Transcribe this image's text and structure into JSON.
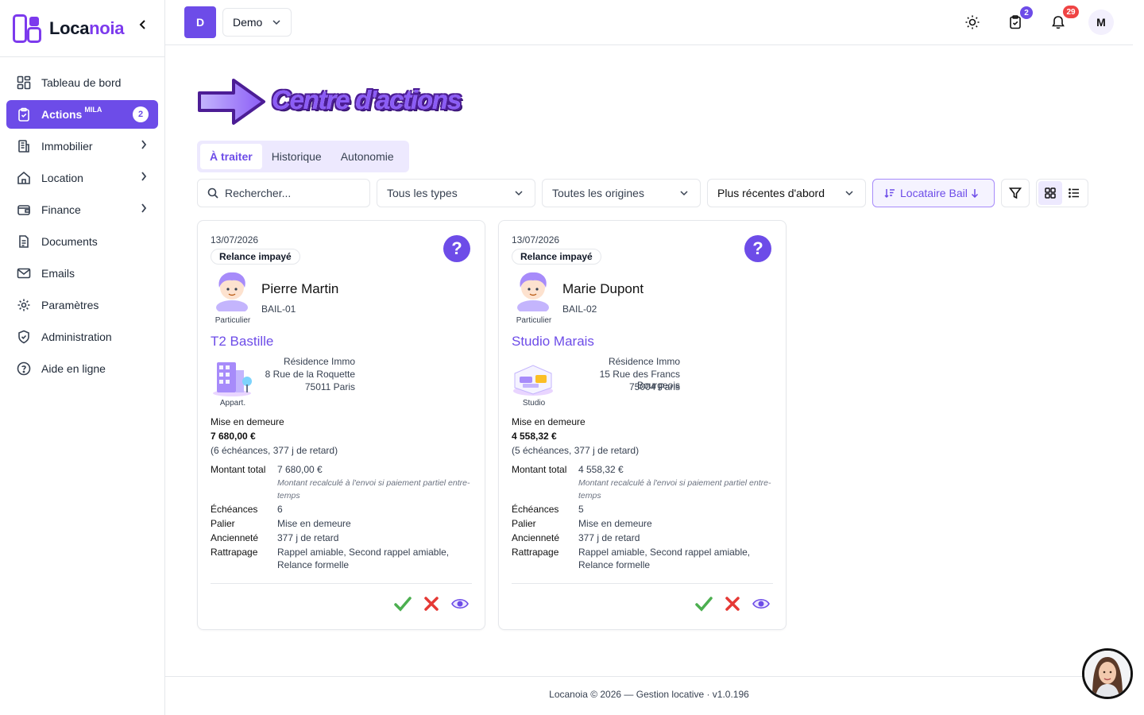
{
  "brand": {
    "name_a": "Loca",
    "name_b": "noia",
    "collapse_icon": "chevron-left-icon"
  },
  "colors": {
    "accent": "#6d4ce8",
    "danger": "#ef4444",
    "success": "#22c55e"
  },
  "sidebar": {
    "items": [
      {
        "label": "Tableau de bord",
        "icon": "dashboard-icon"
      },
      {
        "label": "Actions",
        "sup": "MILA",
        "badge": "2",
        "icon": "clipboard-check-icon",
        "active": true
      },
      {
        "label": "Immobilier",
        "icon": "building-icon",
        "has_children": true
      },
      {
        "label": "Location",
        "icon": "home-icon",
        "has_children": true
      },
      {
        "label": "Finance",
        "icon": "wallet-icon",
        "has_children": true
      },
      {
        "label": "Documents",
        "icon": "document-icon"
      },
      {
        "label": "Emails",
        "icon": "mail-icon"
      },
      {
        "label": "Paramètres",
        "icon": "gear-icon"
      },
      {
        "label": "Administration",
        "icon": "shield-icon"
      },
      {
        "label": "Aide en ligne",
        "icon": "help-circle-icon"
      }
    ]
  },
  "topbar": {
    "org_initial": "D",
    "org_name": "Demo",
    "tasks_badge": "2",
    "notifications_badge": "29",
    "user_initial": "M"
  },
  "hero": {
    "title": "Centre d'actions"
  },
  "tabs": [
    {
      "label": "À traiter",
      "active": true
    },
    {
      "label": "Historique"
    },
    {
      "label": "Autonomie"
    }
  ],
  "filters": {
    "search_placeholder": "Rechercher...",
    "type_value": "Tous les types",
    "origin_value": "Toutes les origines",
    "order_value": "Plus récentes d'abord",
    "sort_label": "Locataire Bail"
  },
  "cards": [
    {
      "date": "13/07/2026",
      "type": "Relance impayé",
      "tenant": "Pierre Martin",
      "tenant_category": "Particulier",
      "lease": "BAIL-01",
      "property": "T2 Bastille",
      "property_type": "Appart.",
      "address": [
        "Résidence Immo",
        "8 Rue de la Roquette",
        "75011 Paris"
      ],
      "stage": "Mise en demeure",
      "amount": "7 680,00 €",
      "detail": "(6 échéances, 377 j de retard)",
      "rows": {
        "total_label": "Montant total",
        "total_value": "7 680,00 €",
        "note": "Montant recalculé à l'envoi si paiement partiel entre-temps",
        "echeances_label": "Échéances",
        "echeances_value": "6",
        "palier_label": "Palier",
        "palier_value": "Mise en demeure",
        "anciennete_label": "Ancienneté",
        "anciennete_value": "377 j de retard",
        "rattrapage_label": "Rattrapage",
        "rattrapage_value_1": "Rappel amiable, Second rappel amiable,",
        "rattrapage_value_2": "Relance formelle"
      }
    },
    {
      "date": "13/07/2026",
      "type": "Relance impayé",
      "tenant": "Marie Dupont",
      "tenant_category": "Particulier",
      "lease": "BAIL-02",
      "property": "Studio Marais",
      "property_type": "Studio",
      "address": [
        "Résidence Immo",
        "15 Rue des Francs Bourgeois",
        "75004 Paris"
      ],
      "stage": "Mise en demeure",
      "amount": "4 558,32 €",
      "detail": "(5 échéances, 377 j de retard)",
      "rows": {
        "total_label": "Montant total",
        "total_value": "4 558,32 €",
        "note": "Montant recalculé à l'envoi si paiement partiel entre-temps",
        "echeances_label": "Échéances",
        "echeances_value": "5",
        "palier_label": "Palier",
        "palier_value": "Mise en demeure",
        "anciennete_label": "Ancienneté",
        "anciennete_value": "377 j de retard",
        "rattrapage_label": "Rattrapage",
        "rattrapage_value_1": "Rappel amiable, Second rappel amiable,",
        "rattrapage_value_2": "Relance formelle"
      }
    }
  ],
  "footer": {
    "text": "Locanoia © 2026 — Gestion locative · v1.0.196"
  }
}
